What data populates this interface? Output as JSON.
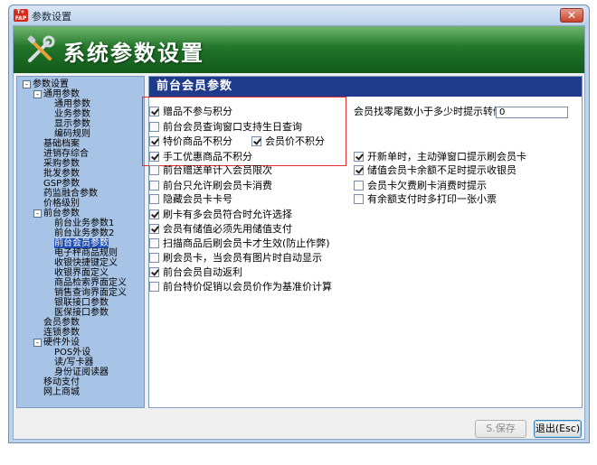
{
  "window": {
    "title": "参数设置",
    "icon_text_top": "T+",
    "icon_text_bottom": "FAP"
  },
  "banner": {
    "title": "系统参数设置"
  },
  "tree": [
    {
      "label": "参数设置",
      "level": 0,
      "expander": "-"
    },
    {
      "label": "通用参数",
      "level": 1,
      "expander": "-"
    },
    {
      "label": "通用参数",
      "level": 2
    },
    {
      "label": "业务参数",
      "level": 2
    },
    {
      "label": "显示参数",
      "level": 2
    },
    {
      "label": "编码规则",
      "level": 2
    },
    {
      "label": "基础档案",
      "level": 1
    },
    {
      "label": "进销存综合",
      "level": 1
    },
    {
      "label": "采购参数",
      "level": 1
    },
    {
      "label": "批发参数",
      "level": 1
    },
    {
      "label": "GSP参数",
      "level": 1
    },
    {
      "label": "药监融合参数",
      "level": 1
    },
    {
      "label": "价格级别",
      "level": 1
    },
    {
      "label": "前台参数",
      "level": 1,
      "expander": "-"
    },
    {
      "label": "前台业务参数1",
      "level": 2
    },
    {
      "label": "前台业务参数2",
      "level": 2
    },
    {
      "label": "前台会员参数",
      "level": 2,
      "selected": true
    },
    {
      "label": "电子秤商品规则",
      "level": 2
    },
    {
      "label": "收银快捷键定义",
      "level": 2
    },
    {
      "label": "收银界面定义",
      "level": 2
    },
    {
      "label": "商品检索界面定义",
      "level": 2
    },
    {
      "label": "销售查询界面定义",
      "level": 2
    },
    {
      "label": "银联接口参数",
      "level": 2
    },
    {
      "label": "医保接口参数",
      "level": 2
    },
    {
      "label": "会员参数",
      "level": 1
    },
    {
      "label": "连锁参数",
      "level": 1
    },
    {
      "label": "硬件外设",
      "level": 1,
      "expander": "-"
    },
    {
      "label": "POS外设",
      "level": 2
    },
    {
      "label": "读/写卡器",
      "level": 2
    },
    {
      "label": "身份证阅读器",
      "level": 2
    },
    {
      "label": "移动支付",
      "level": 1
    },
    {
      "label": "网上商城",
      "level": 1
    }
  ],
  "panel": {
    "title": "前台会员参数",
    "left_options": [
      {
        "label": "赠品不参与积分",
        "checked": true
      },
      {
        "label": "前台会员查询窗口支持生日查询",
        "checked": false
      },
      {
        "label": "特价商品不积分",
        "checked": true
      },
      {
        "label": "手工优惠商品不积分",
        "checked": true
      },
      {
        "label": "前台赠送单计入会员限次",
        "checked": false
      },
      {
        "label": "前台只允许刷会员卡消费",
        "checked": false
      },
      {
        "label": "隐藏会员卡卡号",
        "checked": false
      },
      {
        "label": "刷卡有多会员符合时允许选择",
        "checked": true
      },
      {
        "label": "会员有储值必须先用储值支付",
        "checked": true
      },
      {
        "label": "扫描商品后刷会员卡才生效(防止作弊)",
        "checked": false
      },
      {
        "label": "刷会员卡，当会员有图片时自动显示",
        "checked": false
      },
      {
        "label": "前台会员自动返利",
        "checked": true
      },
      {
        "label": "前台特价促销以会员价作为基准价计算",
        "checked": false
      }
    ],
    "member_price_option": {
      "label": "会员价不积分",
      "checked": true
    },
    "right_options": [
      {
        "label": "开新单时，主动弹窗口提示刷会员卡",
        "checked": true
      },
      {
        "label": "储值会员卡余额不足时提示收银员",
        "checked": true
      },
      {
        "label": "会员卡欠费刷卡消费时提示",
        "checked": false
      },
      {
        "label": "有余额支付时多打印一张小票",
        "checked": false
      }
    ],
    "zero_tail": {
      "label": "会员找零尾数小于多少时提示转储:",
      "value": "0"
    }
  },
  "buttons": {
    "save": "S.保存",
    "exit": "退出(Esc)"
  }
}
